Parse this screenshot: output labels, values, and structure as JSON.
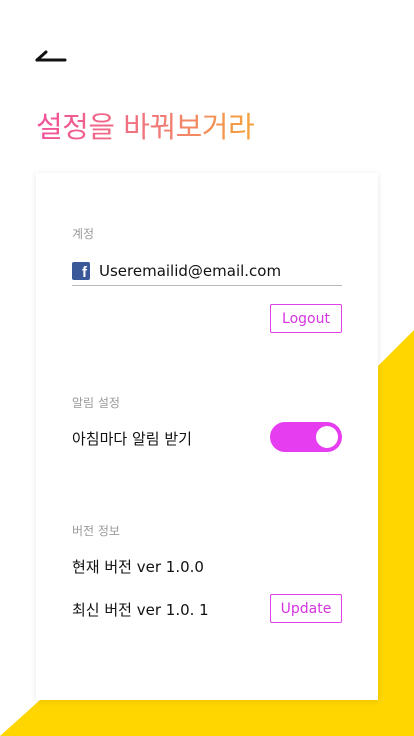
{
  "header": {
    "back_icon": "back-arrow-icon",
    "title": "설정을 바꿔보거라"
  },
  "account": {
    "section_label": "계정",
    "provider_icon": "facebook-icon",
    "email": "Useremailid@email.com",
    "logout_label": "Logout"
  },
  "notifications": {
    "section_label": "알림 설정",
    "morning_label": "아침마다 알림 받기",
    "morning_enabled": true
  },
  "version": {
    "section_label": "버전 정보",
    "current": "현재 버전 ver 1.0.0",
    "latest": "최신 버전 ver 1.0. 1",
    "update_label": "Update"
  },
  "colors": {
    "accent": "#e63df0",
    "background_shape": "#ffd600",
    "facebook": "#3b5998",
    "title_gradient": [
      "#f0509a",
      "#f5a23a"
    ]
  }
}
